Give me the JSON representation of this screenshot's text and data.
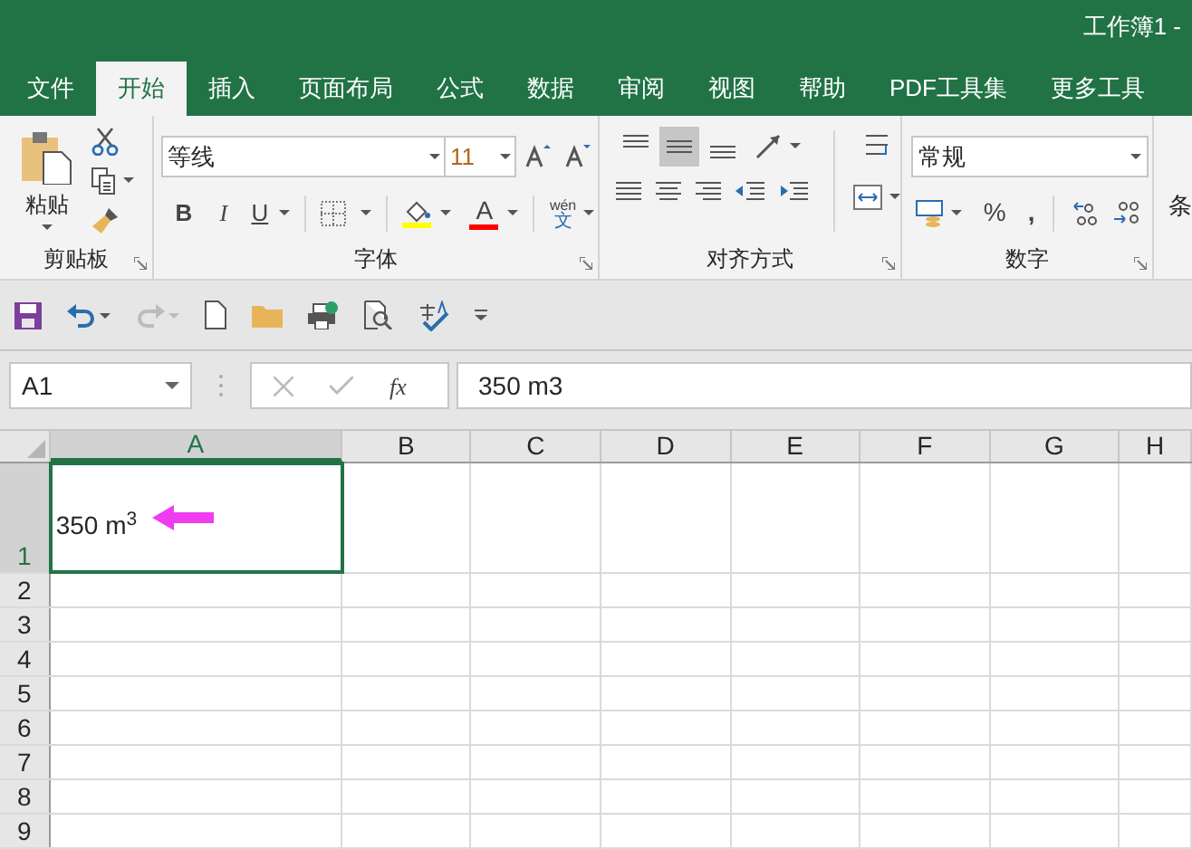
{
  "window": {
    "title": "工作簿1 -"
  },
  "tabs": [
    {
      "label": "文件",
      "selected": false
    },
    {
      "label": "开始",
      "selected": true
    },
    {
      "label": "插入",
      "selected": false
    },
    {
      "label": "页面布局",
      "selected": false
    },
    {
      "label": "公式",
      "selected": false
    },
    {
      "label": "数据",
      "selected": false
    },
    {
      "label": "审阅",
      "selected": false
    },
    {
      "label": "视图",
      "selected": false
    },
    {
      "label": "帮助",
      "selected": false
    },
    {
      "label": "PDF工具集",
      "selected": false
    },
    {
      "label": "更多工具",
      "selected": false
    }
  ],
  "ribbon": {
    "clipboard": {
      "paste_label": "粘贴",
      "group_label": "剪贴板"
    },
    "font": {
      "font_name": "等线",
      "font_size": "11",
      "bold": "B",
      "italic": "I",
      "underline": "U",
      "font_color": "A",
      "phonetic": "wén",
      "phonetic_char": "文",
      "group_label": "字体"
    },
    "alignment": {
      "vertical_align": [
        {
          "selected": false
        },
        {
          "selected": true
        },
        {
          "selected": false
        }
      ],
      "group_label": "对齐方式"
    },
    "number": {
      "format": "常规",
      "percent": "%",
      "comma": ",",
      "group_label": "数字"
    },
    "next_group_partial": "条"
  },
  "formula_bar": {
    "name_box": "A1",
    "fx": "fx",
    "value": "350 m3"
  },
  "sheet": {
    "columns": [
      {
        "label": "A",
        "selected": true
      },
      {
        "label": "B",
        "selected": false
      },
      {
        "label": "C",
        "selected": false
      },
      {
        "label": "D",
        "selected": false
      },
      {
        "label": "E",
        "selected": false
      },
      {
        "label": "F",
        "selected": false
      },
      {
        "label": "G",
        "selected": false
      },
      {
        "label": "H",
        "selected": false
      }
    ],
    "rows": [
      {
        "label": "1",
        "selected": true,
        "cells": [
          "350 m$^{3}$"
        ]
      },
      {
        "label": "2",
        "selected": false
      },
      {
        "label": "3",
        "selected": false
      },
      {
        "label": "4",
        "selected": false
      },
      {
        "label": "5",
        "selected": false
      },
      {
        "label": "6",
        "selected": false
      },
      {
        "label": "7",
        "selected": false
      },
      {
        "label": "8",
        "selected": false
      },
      {
        "label": "9",
        "selected": false
      }
    ]
  }
}
